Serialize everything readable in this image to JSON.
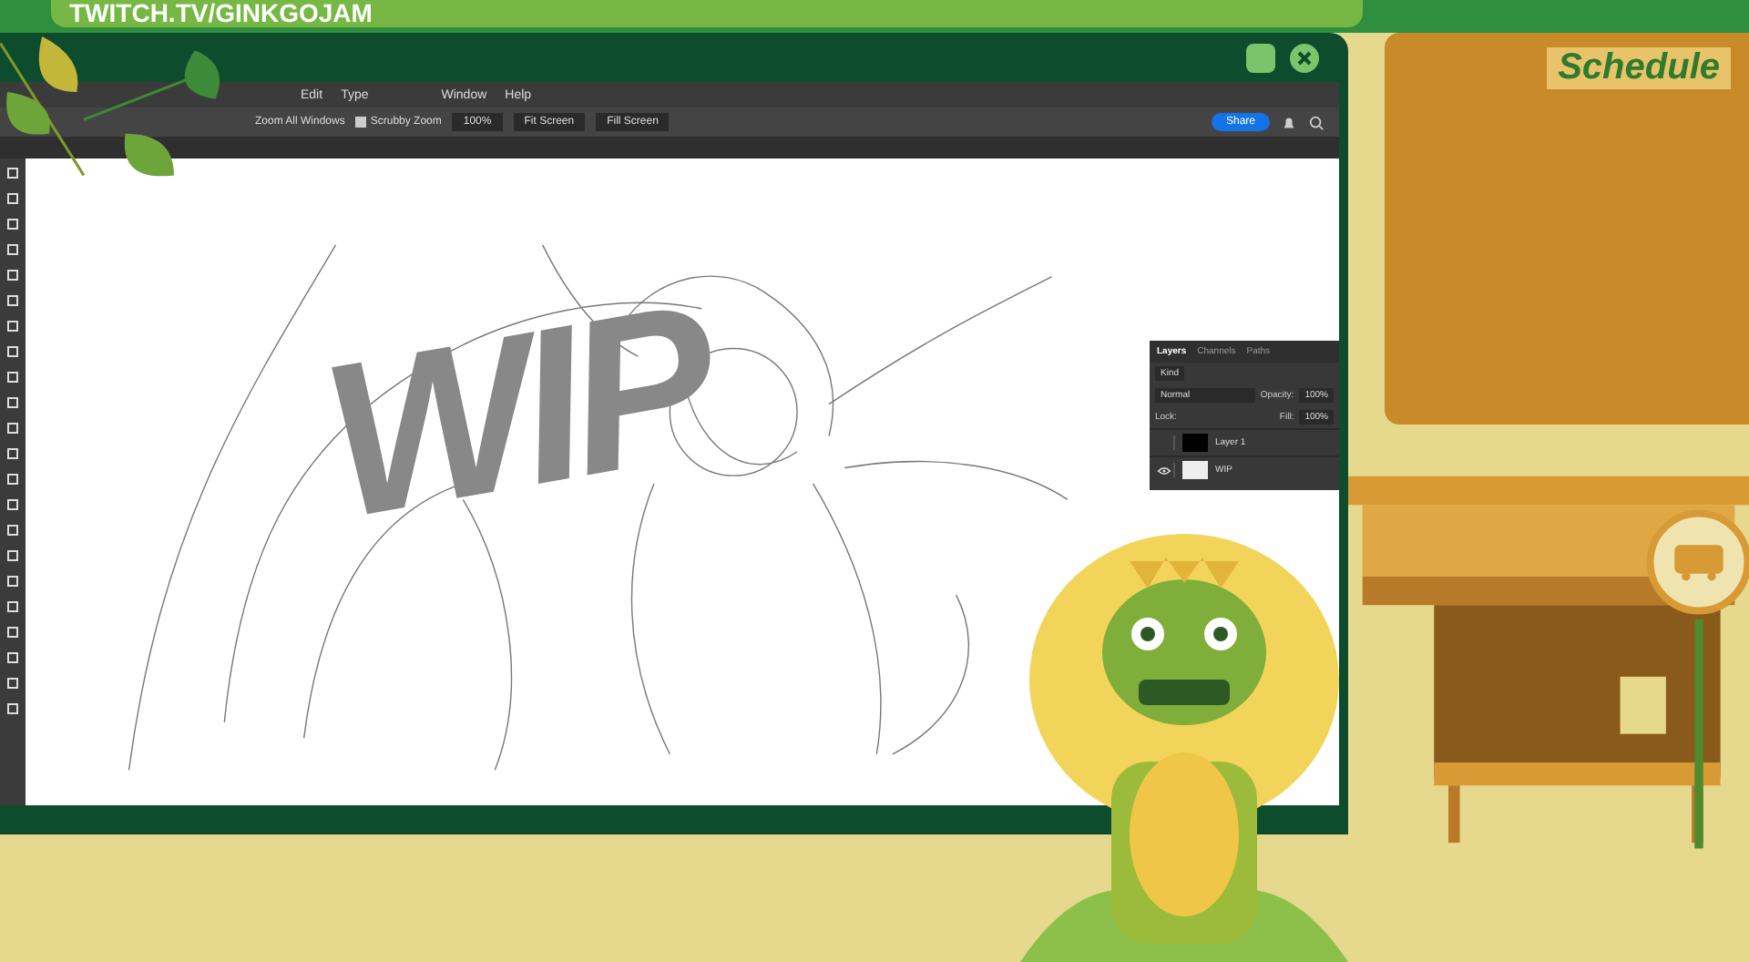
{
  "address_bar": {
    "url": "TWITCH.TV/GINKGOJAM"
  },
  "editor": {
    "menu": [
      "Edit",
      "Type",
      "Window",
      "Help"
    ],
    "options": {
      "zoom_all_label": "Zoom All Windows",
      "scrubby": {
        "label": "Scrubby Zoom",
        "checked": true
      },
      "buttons": [
        "100%",
        "Fit Screen",
        "Fill Screen"
      ],
      "share": "Share"
    },
    "canvas_text": "WIP",
    "layers_panel": {
      "tabs": [
        {
          "label": "Layers",
          "selected": true
        },
        {
          "label": "Channels",
          "selected": false
        },
        {
          "label": "Paths",
          "selected": false
        }
      ],
      "search": "Kind",
      "blend": "Normal",
      "opacity_label": "Opacity:",
      "opacity": "100%",
      "lock_label": "Lock:",
      "fill_label": "Fill:",
      "fill": "100%",
      "layers": [
        {
          "name": "Layer 1",
          "visible": false
        },
        {
          "name": "WIP",
          "visible": true
        }
      ]
    }
  },
  "schedule": {
    "title": "Schedule"
  }
}
